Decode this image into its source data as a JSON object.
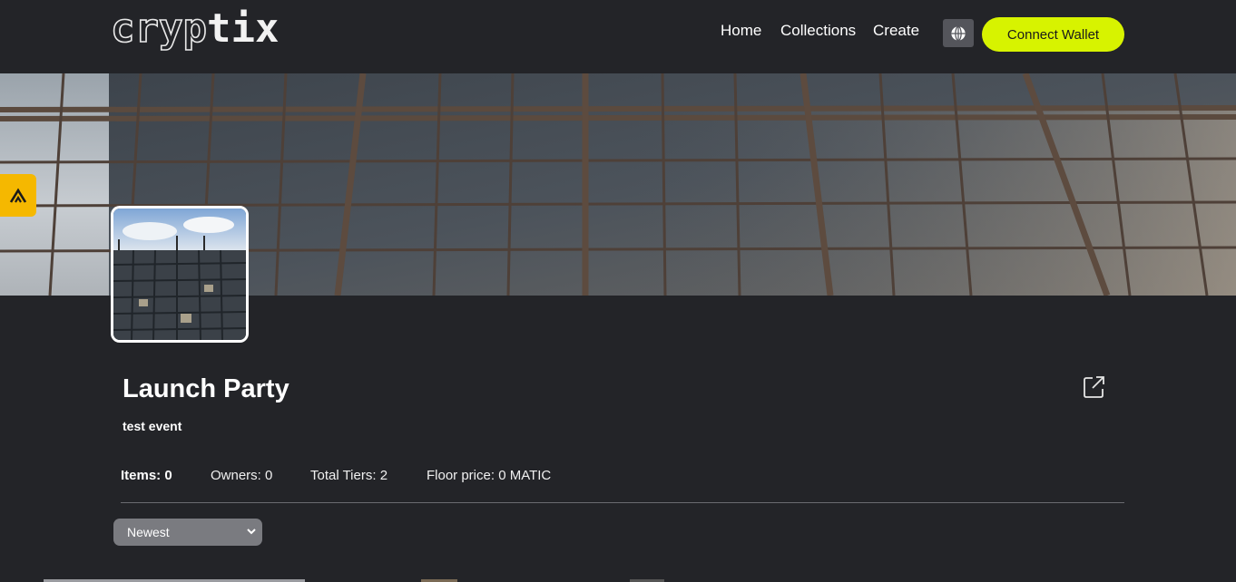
{
  "header": {
    "logo_outline": "cryp",
    "logo_solid": "tix",
    "nav": [
      {
        "label": "Home"
      },
      {
        "label": "Collections"
      },
      {
        "label": "Create"
      }
    ],
    "language_icon": "globe-icon",
    "connect_wallet_label": "Connect Wallet"
  },
  "banner": {
    "side_tab_icon": "chevron-up-logo-icon"
  },
  "collection": {
    "title": "Launch Party",
    "description": "test event",
    "share_icon": "external-link-icon",
    "stats": {
      "items": "Items: 0",
      "owners": "Owners: 0",
      "total_tiers": "Total Tiers: 2",
      "floor_price": "Floor price: 0 MATIC"
    },
    "sort": {
      "selected": "Newest"
    }
  },
  "colors": {
    "background": "#232428",
    "accent": "#d7f300",
    "side_tab": "#f5b800"
  }
}
